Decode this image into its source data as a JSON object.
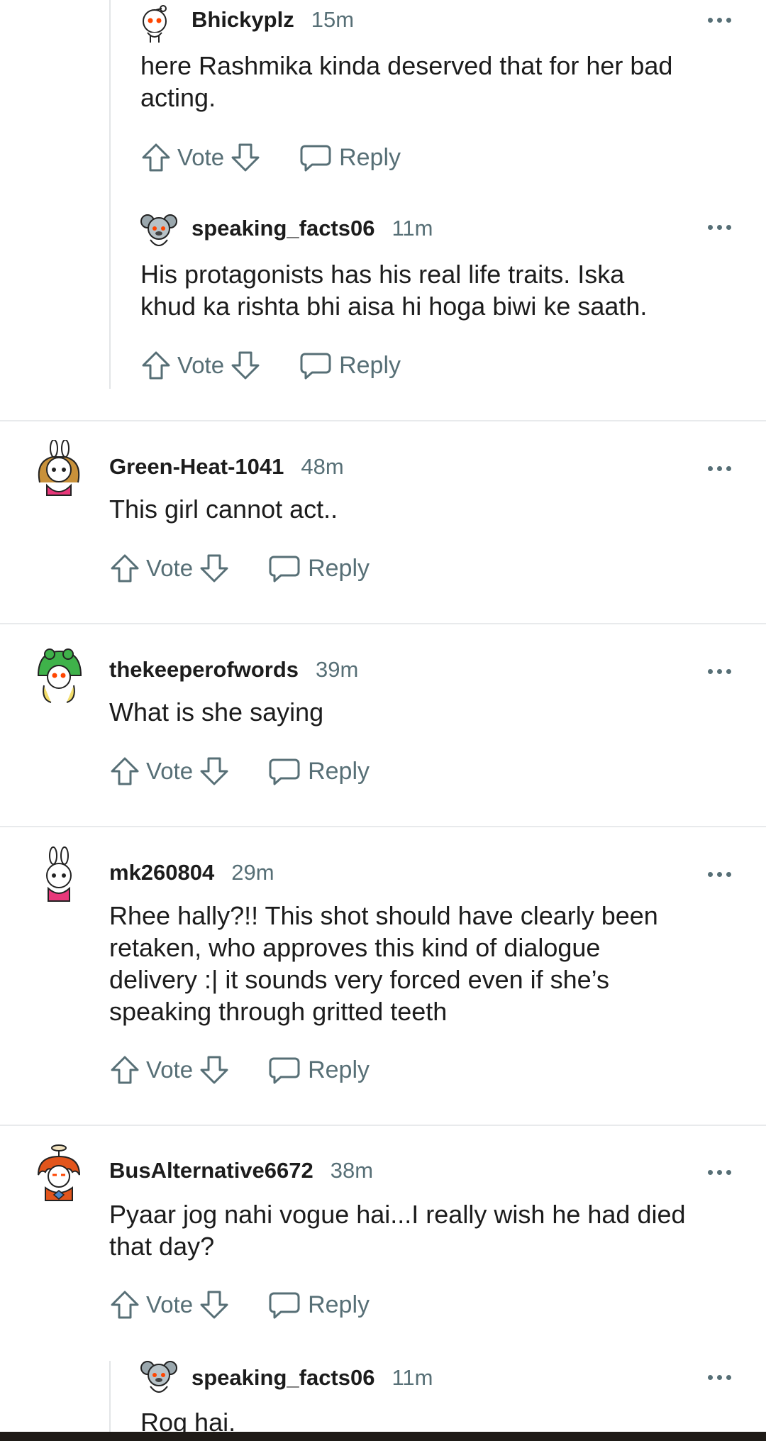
{
  "labels": {
    "vote": "Vote",
    "reply": "Reply"
  },
  "colors": {
    "meta": "#576f76",
    "text": "#1c1c1c",
    "divider": "#e8eaec"
  },
  "comments": [
    {
      "author": "Bhickyplz",
      "time": "15m",
      "lines": [
        "here Rashmika kinda deserved that for her bad",
        "acting."
      ],
      "avatar": "snoo-plain-avatar"
    },
    {
      "author": "speaking_facts06",
      "time": "11m",
      "lines": [
        "His protagonists has his real life traits. Iska",
        "khud ka rishta bhi aisa hi hoga biwi ke saath."
      ],
      "avatar": "snoo-koala-avatar"
    },
    {
      "author": "Green-Heat-1041",
      "time": "48m",
      "lines": [
        "This girl cannot act.."
      ],
      "avatar": "snoo-bunny-girl-avatar"
    },
    {
      "author": "thekeeperofwords",
      "time": "39m",
      "lines": [
        "What is she saying"
      ],
      "avatar": "snoo-frog-hood-avatar"
    },
    {
      "author": "mk260804",
      "time": "29m",
      "lines": [
        "Rhee hally?!! This shot should have clearly been",
        "retaken, who approves this kind of dialogue",
        "delivery :| it sounds very forced even if she’s",
        "speaking through gritted teeth"
      ],
      "avatar": "snoo-bunny-avatar"
    },
    {
      "author": "BusAlternative6672",
      "time": "38m",
      "lines": [
        "Pyaar jog nahi vogue hai...I really wish he had died",
        "that day?"
      ],
      "avatar": "snoo-redhead-avatar"
    },
    {
      "author": "speaking_facts06",
      "time": "11m",
      "lines": [
        "Rog hai."
      ],
      "avatar": "snoo-koala-avatar"
    }
  ]
}
